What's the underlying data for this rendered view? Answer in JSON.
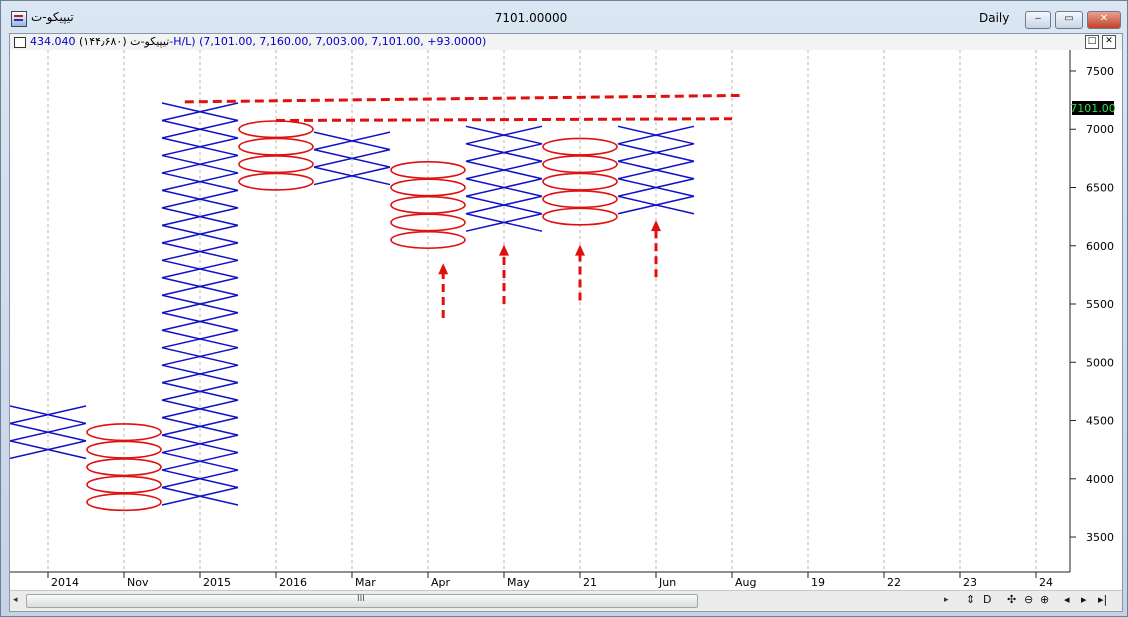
{
  "window": {
    "title": "تیپیکو-ت",
    "center_value": "7101.00000",
    "period": "Daily",
    "buttons": [
      "‒",
      "▭",
      "✕"
    ]
  },
  "infobar": {
    "name": "تیپیکو-ت (۱۴۴٫۶۸۰)",
    "values": "434.040-H/L) (7,101.00, 7,160.00, 7,003.00, 7,101.00, +93.0000)",
    "buttons": [
      "□",
      "✕"
    ]
  },
  "price_label": "7101.00",
  "scrollbar": {
    "grip": "III",
    "left_arrow": "◂",
    "right_arrow": "▸",
    "tools": [
      "⇕",
      "D",
      "✣",
      "⊖",
      "⊕",
      "◂",
      "▸",
      "▸|"
    ]
  },
  "colors": {
    "x": "#1010c8",
    "o": "#e01010",
    "annotation": "#e01010",
    "grid": "#b4b4b4"
  },
  "chart_data": {
    "type": "point-and-figure",
    "box_size": 150,
    "y_ticks": [
      7500,
      7000,
      6500,
      6000,
      5500,
      5000,
      4500,
      4000,
      3500
    ],
    "ylim": [
      3200,
      7680
    ],
    "x_labels": [
      "2014",
      "Nov",
      "2015",
      "2016",
      "Mar",
      "Apr",
      "May",
      "21",
      "Jun",
      "Aug",
      "19",
      "22",
      "23",
      "24"
    ],
    "columns": [
      {
        "kind": "X",
        "low": 4250,
        "high": 4550
      },
      {
        "kind": "O",
        "low": 3800,
        "high": 4400
      },
      {
        "kind": "X",
        "low": 3850,
        "high": 7150
      },
      {
        "kind": "O",
        "low": 6550,
        "high": 7000
      },
      {
        "kind": "X",
        "low": 6600,
        "high": 6900
      },
      {
        "kind": "O",
        "low": 6050,
        "high": 6700
      },
      {
        "kind": "X",
        "low": 6200,
        "high": 7000
      },
      {
        "kind": "O",
        "low": 6250,
        "high": 6850
      },
      {
        "kind": "X",
        "low": 6350,
        "high": 7000
      }
    ],
    "current_price": 7101,
    "trendlines": [
      {
        "c1": 1.8,
        "v1": 7235,
        "c2": 9.1,
        "v2": 7290
      },
      {
        "c1": 3.0,
        "v1": 7075,
        "c2": 9.0,
        "v2": 7090
      }
    ],
    "arrows": [
      {
        "col": 5.2,
        "from": 5380,
        "to": 5850
      },
      {
        "col": 6.0,
        "from": 5500,
        "to": 6010
      },
      {
        "col": 7.0,
        "from": 5530,
        "to": 6010
      },
      {
        "col": 8.0,
        "from": 5730,
        "to": 6220
      }
    ]
  }
}
